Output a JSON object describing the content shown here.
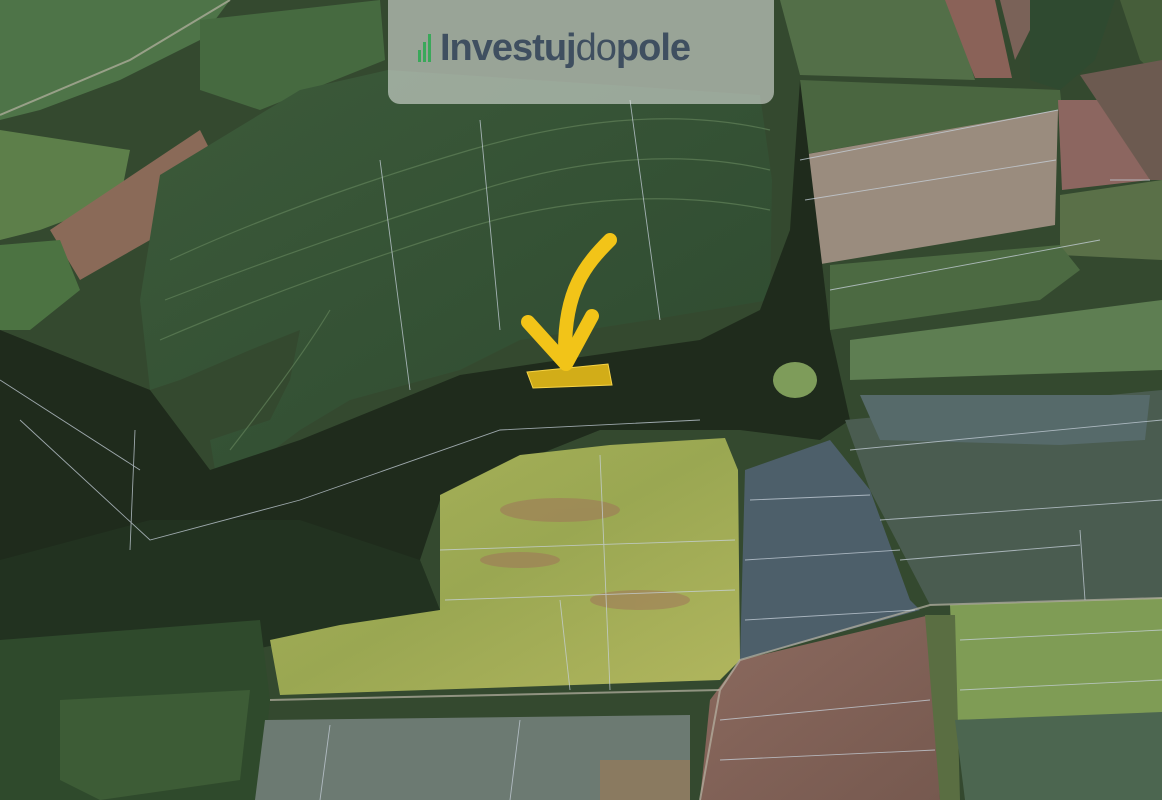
{
  "map": {
    "type": "satellite-cadastral",
    "highlight_color": "#f2c418",
    "arrow_color": "#f2c418",
    "parcel_line_color": "#c8d2dc"
  },
  "brand": {
    "part1": "Investuj",
    "part2": "do",
    "part3": "pole",
    "text_color": "#3f4f60",
    "accent_color": "#3aa85a",
    "icon": "bar-chart-icon"
  }
}
